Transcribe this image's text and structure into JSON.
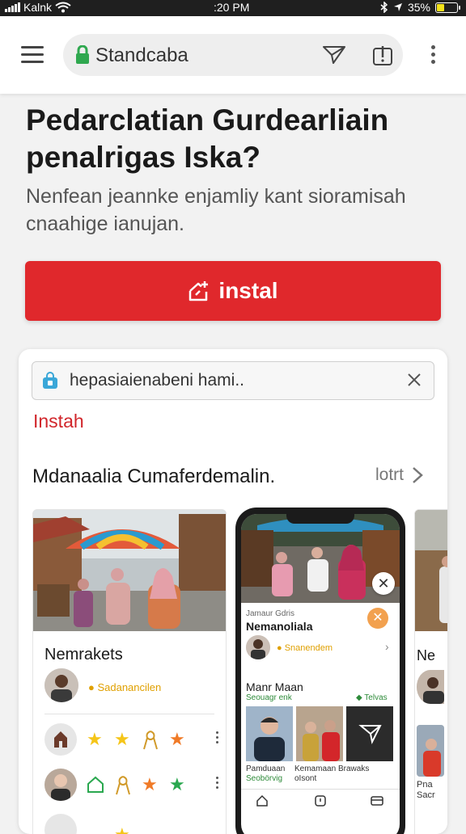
{
  "status_bar": {
    "carrier": "Kalnk",
    "time": ":20 PM",
    "battery": "35%",
    "battery_level": 0.35
  },
  "browser": {
    "url": "Standcaba"
  },
  "hero": {
    "title": "Pedarclatian Gurdearliain penalrigas Iska?",
    "subtitle": "Nenfean jeannke enjamliy kant sioramisah cnaahige ianujan.",
    "install_label": "instal"
  },
  "card": {
    "search_text": "hepasiaienabeni hami..",
    "instah": "Instah",
    "section_heading": "Mdanaalia Cumaferdemalin.",
    "see_all": "lotrt",
    "market": {
      "title": "Nemrakets",
      "tag": "Sadanancilen"
    },
    "phone": {
      "small_label": "Jamaur Gdris",
      "title": "Nemanoliala",
      "tag": "Snanendem",
      "subhead": "Manr Maan",
      "sub_left": "Seouagr enk",
      "sub_right": "Telvas",
      "captions": [
        {
          "line1": "Pamduaan",
          "line2": "Seobörvig"
        },
        {
          "line1": "Kemamaan",
          "line2": "oIsont"
        },
        {
          "line1": "Brawaks",
          "line2": ""
        }
      ]
    },
    "partial": {
      "title": "Ne",
      "line1": "Pna",
      "line2": "Sacr"
    }
  },
  "colors": {
    "accent_red": "#e0282c",
    "lock_green": "#2fa84f",
    "tag_orange": "#e0a000",
    "star_yellow": "#f5c518",
    "star_orange": "#f07a27",
    "star_green": "#2aa84f"
  },
  "icons": [
    "menu-icon",
    "lock-icon",
    "send-icon",
    "share-icon",
    "kebab-icon",
    "home-plus-icon",
    "bag-icon",
    "clear-icon",
    "chevron-right-icon",
    "star-icon",
    "ribbon-icon",
    "home-outline-icon",
    "close-icon"
  ]
}
